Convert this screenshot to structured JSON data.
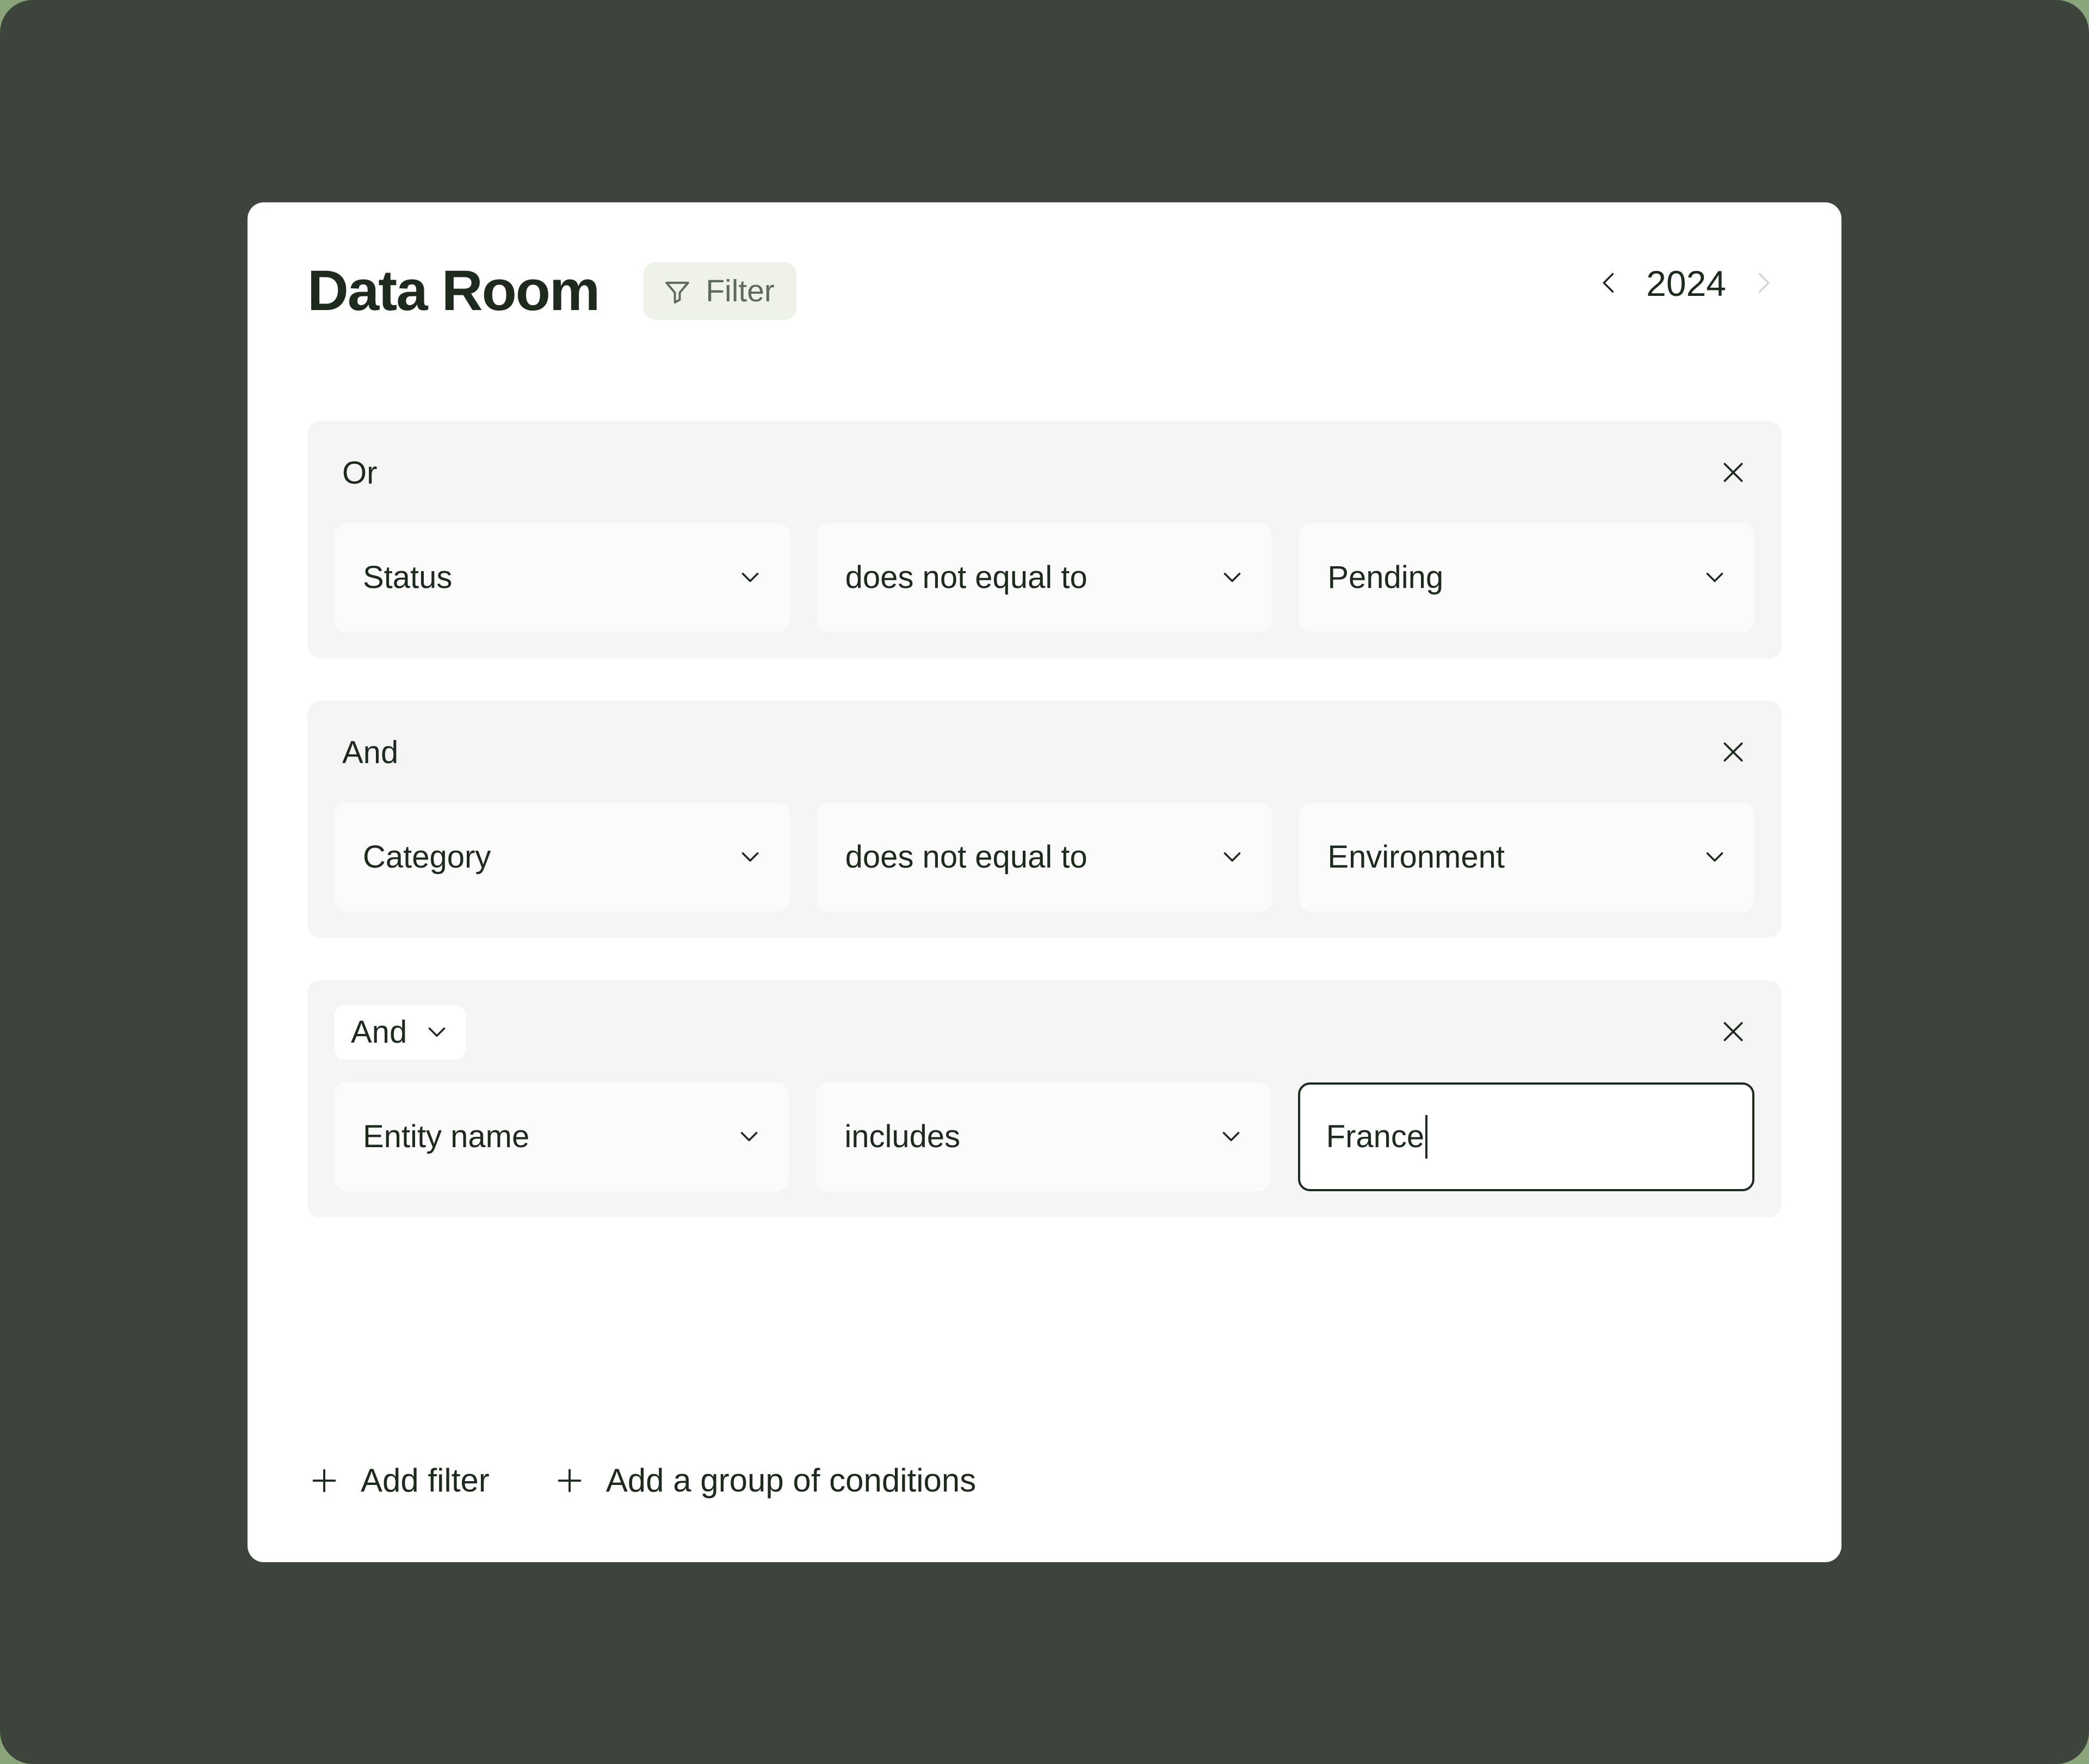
{
  "header": {
    "title": "Data Room",
    "filter_chip": {
      "label": "Filter",
      "icon": "funnel-icon"
    },
    "year_nav": {
      "prev_icon": "chevron-left-icon",
      "next_icon": "chevron-right-icon",
      "year": "2024"
    }
  },
  "groups": [
    {
      "operator": "Or",
      "operator_is_select": false,
      "close_icon": "close-icon",
      "conditions": [
        {
          "type": "select",
          "label": "Status",
          "icon": "chevron-down-icon"
        },
        {
          "type": "select",
          "label": "does not equal to",
          "icon": "chevron-down-icon"
        },
        {
          "type": "select",
          "label": "Pending",
          "icon": "chevron-down-icon"
        }
      ]
    },
    {
      "operator": "And",
      "operator_is_select": false,
      "close_icon": "close-icon",
      "conditions": [
        {
          "type": "select",
          "label": "Category",
          "icon": "chevron-down-icon"
        },
        {
          "type": "select",
          "label": "does not equal to",
          "icon": "chevron-down-icon"
        },
        {
          "type": "select",
          "label": "Environment",
          "icon": "chevron-down-icon"
        }
      ]
    },
    {
      "operator": "And",
      "operator_is_select": true,
      "operator_icon": "chevron-down-icon",
      "close_icon": "close-icon",
      "conditions": [
        {
          "type": "select",
          "label": "Entity name",
          "icon": "chevron-down-icon"
        },
        {
          "type": "select",
          "label": "includes",
          "icon": "chevron-down-icon"
        },
        {
          "type": "input",
          "value": "France",
          "placeholder": "",
          "focused": true
        }
      ]
    }
  ],
  "footer": {
    "add_filter": {
      "label": "Add filter",
      "icon": "plus-icon"
    },
    "add_group": {
      "label": "Add a group of conditions",
      "icon": "plus-icon"
    }
  },
  "colors": {
    "page_background": "#3c443b",
    "card_background": "#ffffff",
    "group_background": "#f5f5f5",
    "pill_background": "#fbfbfb",
    "chip_background": "#eff2e9",
    "text_primary": "#1f2a1e",
    "text_muted": "#5f6a5d",
    "focus_border": "#1f2a1e"
  }
}
